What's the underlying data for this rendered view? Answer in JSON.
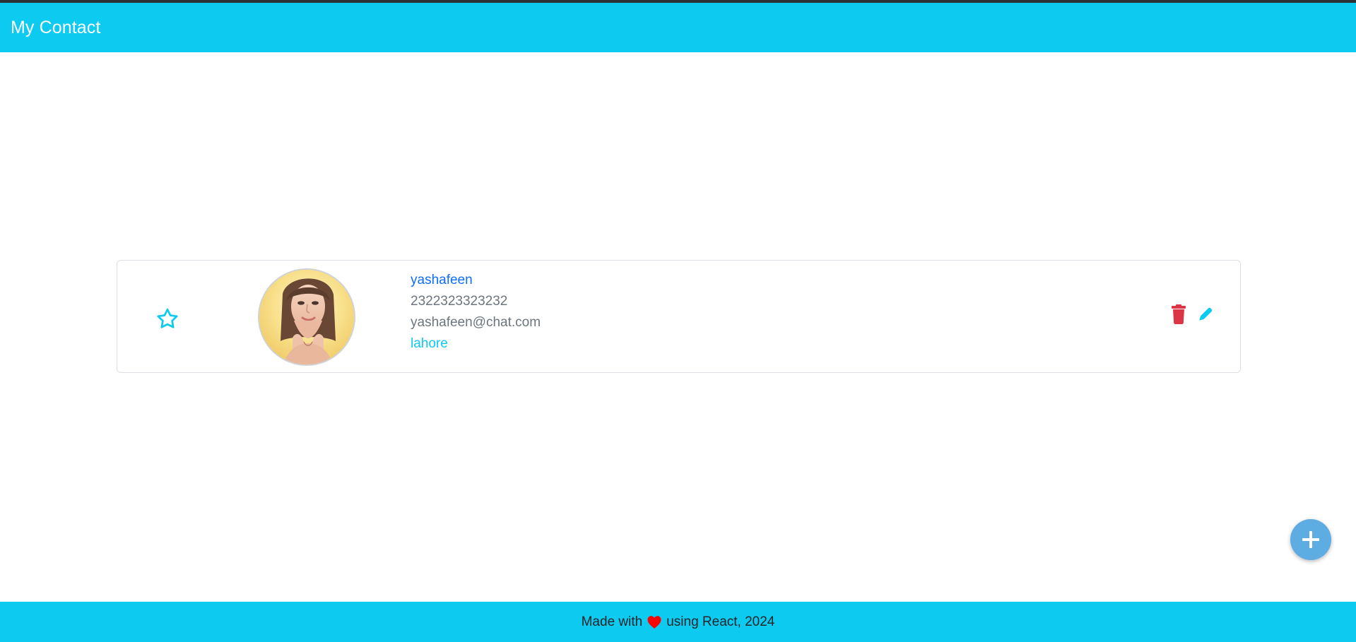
{
  "header": {
    "title": "My Contact"
  },
  "contact": {
    "name": "yashafeen",
    "phone": "2322323323232",
    "email": "yashafeen@chat.com",
    "city": "lahore",
    "favorite": false
  },
  "icons": {
    "favorite": "star-outline-icon",
    "delete": "trash-icon",
    "edit": "pencil-icon",
    "add": "plus-icon",
    "heart": "heart-icon"
  },
  "footer": {
    "prefix": "Made with",
    "suffix": "using React, 2024"
  },
  "colors": {
    "primary": "#0dcaf0",
    "name": "#0d6efd",
    "muted": "#6c757d",
    "delete": "#dc3545",
    "fab": "#5dade2",
    "heart": "#ff0000",
    "topStrip": "#2c3338"
  }
}
